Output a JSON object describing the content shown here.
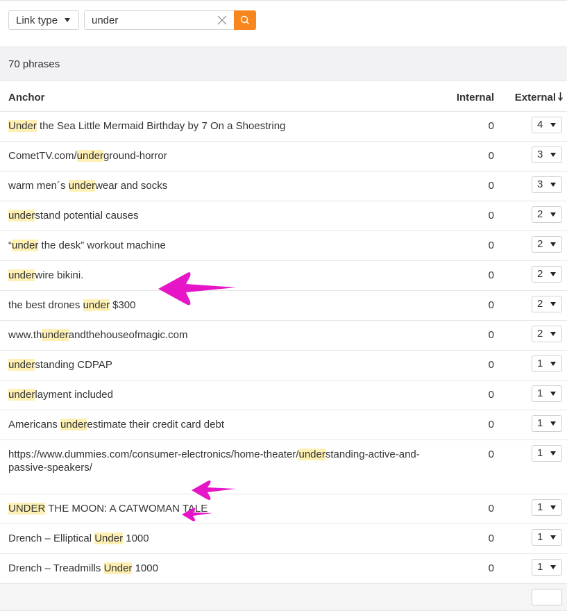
{
  "toolbar": {
    "link_type_label": "Link type",
    "search_value": "under",
    "search_placeholder": "",
    "accent_color": "#f7861e"
  },
  "summary": {
    "count_label": "70 phrases"
  },
  "table": {
    "headers": {
      "anchor": "Anchor",
      "internal": "Internal",
      "external": "External"
    },
    "sort": {
      "column": "external",
      "direction": "desc"
    },
    "highlight_color": "#fdf0b2",
    "rows": [
      {
        "pre": "",
        "hl": "Under",
        "post": " the Sea Little Mermaid Birthday by 7 On a Shoestring",
        "internal": "0",
        "external": "4"
      },
      {
        "pre": "CometTV.com/",
        "hl": "under",
        "post": "ground-horror",
        "internal": "0",
        "external": "3"
      },
      {
        "pre": "warm men´s ",
        "hl": "under",
        "post": "wear and socks",
        "internal": "0",
        "external": "3"
      },
      {
        "pre": "",
        "hl": "under",
        "post": "stand potential causes",
        "internal": "0",
        "external": "2"
      },
      {
        "pre": "“",
        "hl": "under",
        "post": " the desk” workout machine",
        "internal": "0",
        "external": "2"
      },
      {
        "pre": "",
        "hl": "under",
        "post": "wire bikini.",
        "internal": "0",
        "external": "2"
      },
      {
        "pre": "the best drones ",
        "hl": "under",
        "post": " $300",
        "internal": "0",
        "external": "2"
      },
      {
        "pre": "www.th",
        "hl": "under",
        "post": "andthehouseofmagic.com",
        "internal": "0",
        "external": "2"
      },
      {
        "pre": "",
        "hl": "under",
        "post": "standing CDPAP",
        "internal": "0",
        "external": "1"
      },
      {
        "pre": "",
        "hl": "under",
        "post": "layment included",
        "internal": "0",
        "external": "1"
      },
      {
        "pre": "Americans ",
        "hl": "under",
        "post": "estimate their credit card debt",
        "internal": "0",
        "external": "1"
      },
      {
        "pre": "https://www.dummies.com/consumer-electronics/home-theater/",
        "hl": "under",
        "post": "standing-active-and-passive-speakers/",
        "internal": "0",
        "external": "1"
      },
      {
        "pre": "",
        "hl": "UNDER",
        "post": " THE MOON: A CATWOMAN TALE",
        "internal": "0",
        "external": "1"
      },
      {
        "pre": "Drench – Elliptical ",
        "hl": "Under",
        "post": " 1000",
        "internal": "0",
        "external": "1"
      },
      {
        "pre": "Drench – Treadmills ",
        "hl": "Under",
        "post": " 1000",
        "internal": "0",
        "external": "1"
      }
    ]
  },
  "annotations": {
    "arrow_color": "#e616c8",
    "arrows_point_to_rows": [
      6,
      13,
      14
    ]
  }
}
